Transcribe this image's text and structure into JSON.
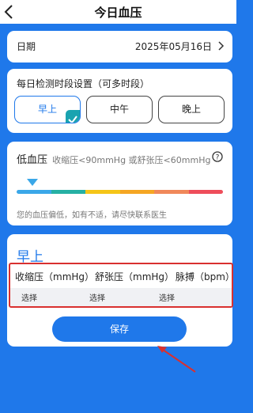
{
  "header": {
    "title": "今日血压",
    "back_icon": "chevron-left-icon"
  },
  "date_row": {
    "label": "日期",
    "value": "2025年05月16日",
    "icon": "chevron-right-icon"
  },
  "period": {
    "title": "每日检测时段设置（可多时段）",
    "options": [
      {
        "label": "早上",
        "selected": true
      },
      {
        "label": "中午",
        "selected": false
      },
      {
        "label": "晚上",
        "selected": false
      }
    ]
  },
  "bp_status": {
    "title": "低血压",
    "range": "收缩压<90mmHg 或舒张压<60mmHg",
    "note": "您的血压偏低，如有不适，请尽快联系医生",
    "scale_colors": [
      "#3aa7e8",
      "#26b0a4",
      "#f5c518",
      "#f5a623",
      "#f0885a",
      "#ee4d5a"
    ],
    "accent": "#1f78ea"
  },
  "morning": {
    "title": "早上",
    "columns": [
      "收缩压（mmHg）",
      "舒张压（mmHg）",
      "脉搏（bpm）"
    ],
    "values": [
      "选择",
      "选择",
      "选择"
    ],
    "save_label": "保存"
  }
}
